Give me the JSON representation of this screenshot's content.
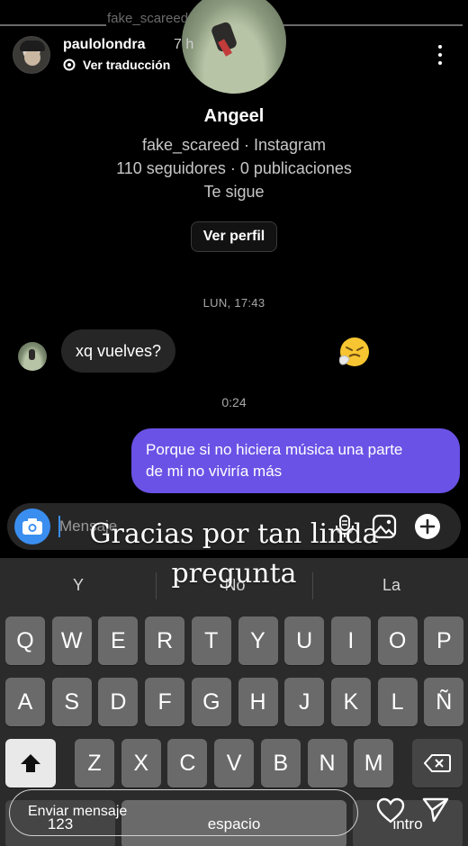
{
  "top_ghost": {
    "handle": "fake_scareed"
  },
  "story": {
    "username": "paulolondra",
    "time": "7 h",
    "translate_label": "Ver traducción",
    "caption_line1": "Gracias por tan linda",
    "caption_line2": "pregunta"
  },
  "profile": {
    "name": "Angeel",
    "subtitle": "fake_scareed · Instagram",
    "stats": "110 seguidores · 0 publicaciones",
    "follows_you": "Te sigue",
    "view_profile_label": "Ver perfil"
  },
  "conversation": {
    "timestamp1": "LUN, 17:43",
    "incoming_message": "xq vuelves?",
    "reaction_emoji": "sneezing-face",
    "timestamp2": "0:24",
    "outgoing_message_line1": "Porque si no hiciera música una parte",
    "outgoing_message_line2": "de mi no viviría más"
  },
  "composer": {
    "placeholder": "Mensaje"
  },
  "keyboard": {
    "suggestions": [
      "Y",
      "No",
      "La"
    ],
    "row1": [
      "Q",
      "W",
      "E",
      "R",
      "T",
      "Y",
      "U",
      "I",
      "O",
      "P"
    ],
    "row2": [
      "A",
      "S",
      "D",
      "F",
      "G",
      "H",
      "J",
      "K",
      "L",
      "Ñ"
    ],
    "row3": [
      "Z",
      "X",
      "C",
      "V",
      "B",
      "N",
      "M"
    ],
    "numbers_label": "123",
    "space_label": "espacio",
    "return_label": "intro"
  },
  "reply": {
    "placeholder": "Enviar mensaje"
  },
  "colors": {
    "outgoing_bubble": "#6a52e6",
    "camera_button": "#3a8ef0",
    "incoming_bubble": "#262626"
  }
}
